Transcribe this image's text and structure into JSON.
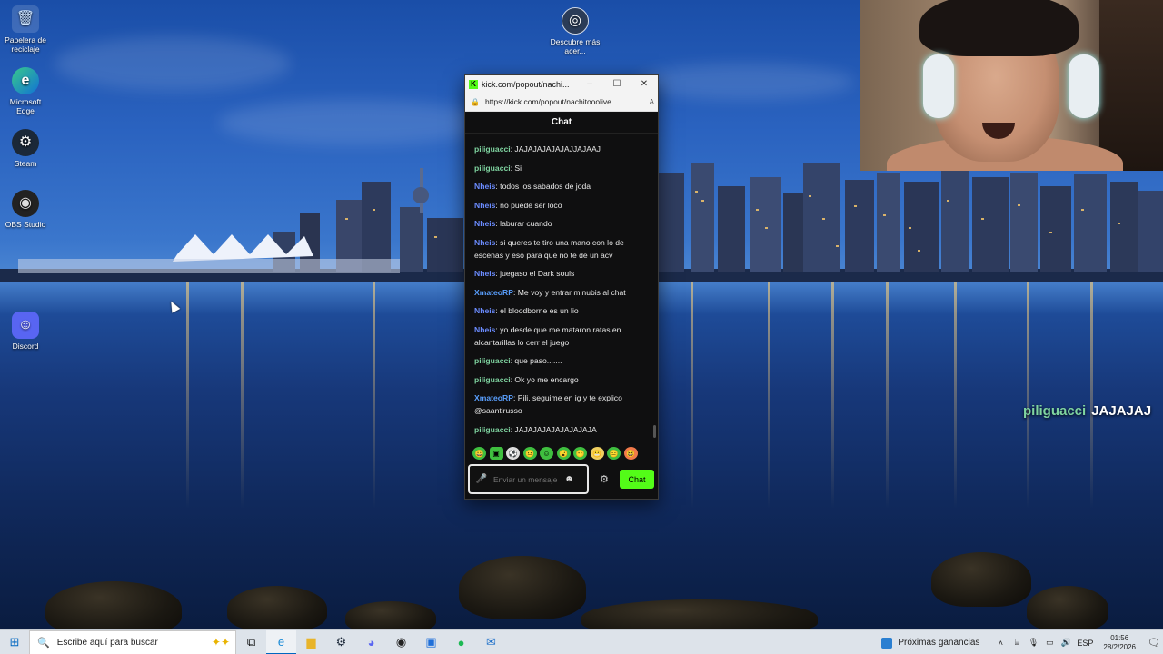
{
  "desktop_icons": [
    {
      "label": "Papelera de reciclaje",
      "icon": "recycle-bin-icon",
      "symbol": "🗑"
    },
    {
      "label": "Microsoft Edge",
      "icon": "edge-icon",
      "symbol": "e"
    },
    {
      "label": "Steam",
      "icon": "steam-icon",
      "symbol": "⚙"
    },
    {
      "label": "OBS Studio",
      "icon": "obs-icon",
      "symbol": "◉"
    },
    {
      "label": "Discord",
      "icon": "discord-icon",
      "symbol": "☺"
    },
    {
      "label": "Descubre más acer...",
      "icon": "discover-icon",
      "symbol": "◎"
    }
  ],
  "popout": {
    "tab_title": "kick.com/popout/nachi...",
    "url": "https://kick.com/popout/nachitooolive...",
    "header": "Chat",
    "messages": [
      {
        "user": "piliguacci",
        "user_color": "#7fd4a0",
        "text": ": JAJAJAJAJAJAJJAJAAJ"
      },
      {
        "user": "piliguacci",
        "user_color": "#7fd4a0",
        "text": ": Si"
      },
      {
        "user": "Nheis",
        "user_color": "#6b8cff",
        "text": ": todos los sabados de joda"
      },
      {
        "user": "Nheis",
        "user_color": "#6b8cff",
        "text": ": no puede ser loco"
      },
      {
        "user": "Nheis",
        "user_color": "#6b8cff",
        "text": ": laburar cuando"
      },
      {
        "user": "Nheis",
        "user_color": "#6b8cff",
        "text": ": si queres te tiro una mano con lo de escenas y eso para que no te de un acv"
      },
      {
        "user": "Nheis",
        "user_color": "#6b8cff",
        "text": ": juegaso el Dark souls"
      },
      {
        "user": "XmateoRP",
        "user_color": "#5aa0ff",
        "text": ": Me voy y entrar minubis al chat"
      },
      {
        "user": "Nheis",
        "user_color": "#6b8cff",
        "text": ": el bloodborne es un lio"
      },
      {
        "user": "Nheis",
        "user_color": "#6b8cff",
        "text": ": yo desde que me mataron ratas en alcantarillas lo cerr el juego"
      },
      {
        "user": "piliguacci",
        "user_color": "#7fd4a0",
        "text": ": que paso......."
      },
      {
        "user": "piliguacci",
        "user_color": "#7fd4a0",
        "text": ": Ok yo me encargo"
      },
      {
        "user": "XmateoRP",
        "user_color": "#5aa0ff",
        "text": ": Pili, seguime en ig y te explico @saantirusso"
      },
      {
        "user": "piliguacci",
        "user_color": "#7fd4a0",
        "text": ": JAJAJAJAJAJAJAJAJA"
      }
    ],
    "input_placeholder": "Enviar un mensaje",
    "send_label": "Chat"
  },
  "overlay": {
    "user": "piliguacci",
    "text": "JAJAJAJ"
  },
  "taskbar": {
    "search_placeholder": "Escribe aquí para buscar",
    "news_label": "Próximas ganancias",
    "language": "ESP",
    "time": "01:56",
    "date": "28/2/2026"
  },
  "colors": {
    "kick_green": "#53fc18",
    "taskbar_bg": "#dde3ea"
  }
}
